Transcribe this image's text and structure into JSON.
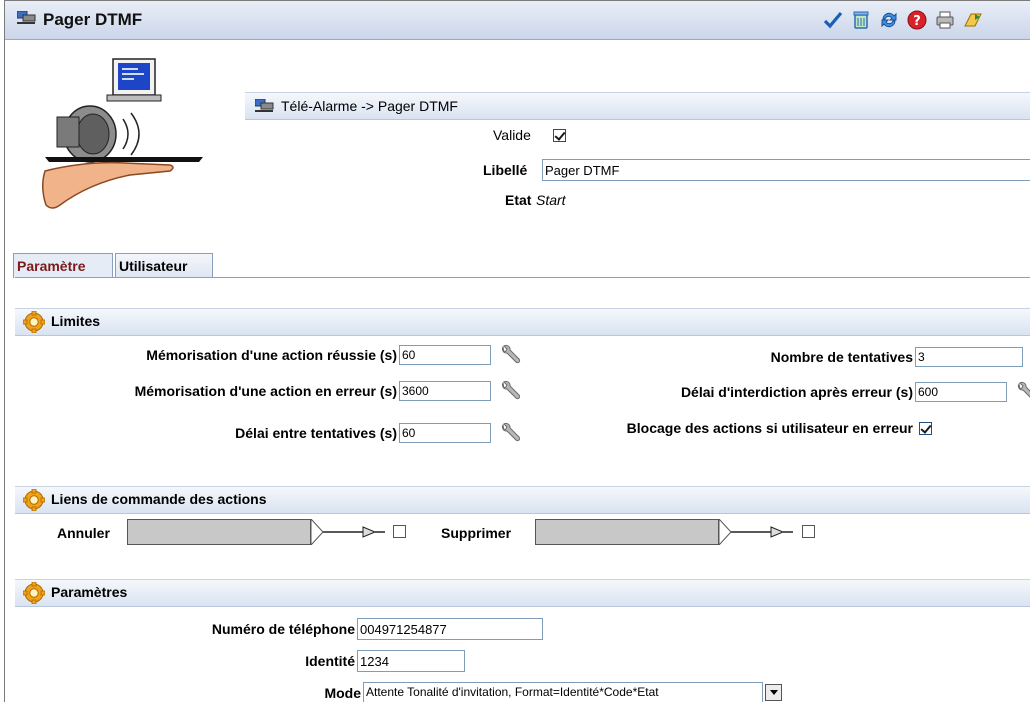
{
  "window": {
    "title": "Pager DTMF"
  },
  "toolbar": {
    "icons": [
      "checkmark-icon",
      "trash-icon",
      "refresh-icon",
      "help-icon",
      "print-icon",
      "export-icon"
    ]
  },
  "header": {
    "breadcrumb": "Télé-Alarme -> Pager DTMF",
    "valide_label": "Valide",
    "valide_checked": true,
    "libelle_label": "Libellé",
    "libelle_value": "Pager DTMF",
    "etat_label": "Etat",
    "etat_value": "Start"
  },
  "tabs": [
    {
      "label": "Paramètre",
      "active": true
    },
    {
      "label": "Utilisateur",
      "active": false
    }
  ],
  "limites": {
    "title": "Limites",
    "mem_reussie_label": "Mémorisation d'une action réussie (s)",
    "mem_reussie_value": "60",
    "mem_erreur_label": "Mémorisation d'une action en erreur (s)",
    "mem_erreur_value": "3600",
    "delai_tentatives_label": "Délai entre tentatives (s)",
    "delai_tentatives_value": "60",
    "nb_tentatives_label": "Nombre de tentatives",
    "nb_tentatives_value": "3",
    "delai_interdiction_label": "Délai d'interdiction après erreur (s)",
    "delai_interdiction_value": "600",
    "blocage_label": "Blocage des actions si utilisateur en erreur",
    "blocage_checked": true
  },
  "liens": {
    "title": "Liens de commande des actions",
    "annuler_label": "Annuler",
    "supprimer_label": "Supprimer"
  },
  "parametres": {
    "title": "Paramètres",
    "telephone_label": "Numéro de téléphone",
    "telephone_value": "004971254877",
    "identite_label": "Identité",
    "identite_value": "1234",
    "mode_label": "Mode",
    "mode_value": "Attente Tonalité d'invitation, Format=Identité*Code*Etat"
  },
  "colors": {
    "accent": "#1a5fb4",
    "tab_active_text": "#7b1a1a",
    "section_bg": "#d9e3f1"
  }
}
